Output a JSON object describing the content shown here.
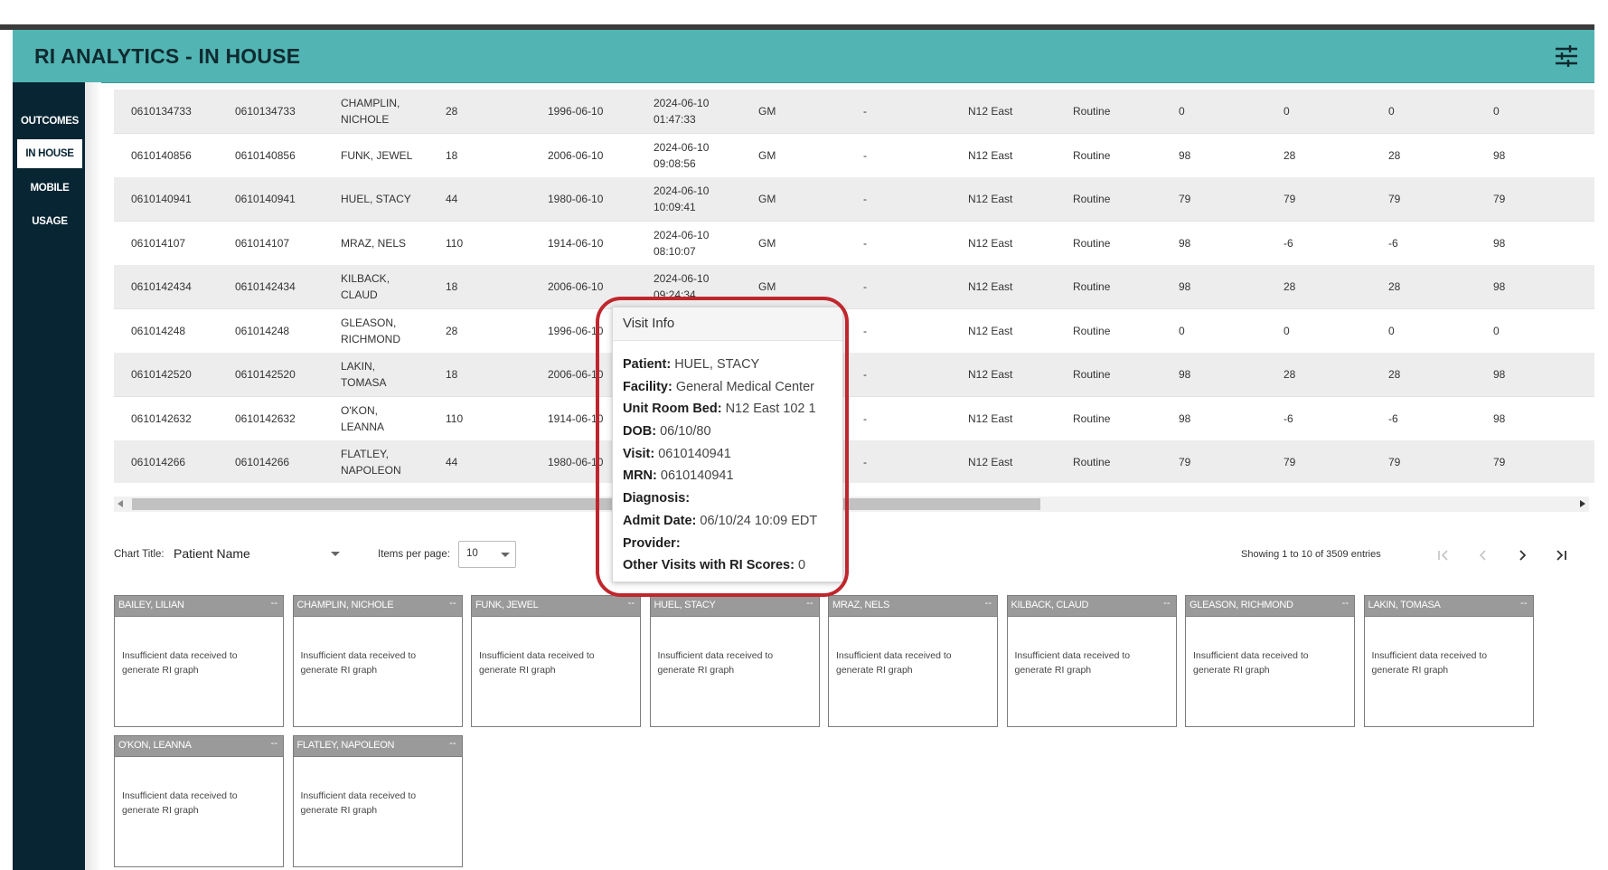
{
  "app": {
    "title": "RI ANALYTICS - IN HOUSE"
  },
  "nav": [
    {
      "label": "OUTCOMES",
      "active": false
    },
    {
      "label": "IN HOUSE",
      "active": true
    },
    {
      "label": "MOBILE",
      "active": false
    },
    {
      "label": "USAGE",
      "active": false
    }
  ],
  "table": {
    "rows": [
      [
        "0610134733",
        "0610134733",
        "CHAMPLIN,\nNICHOLE",
        "28",
        "1996-06-10",
        "2024-06-10\n01:47:33",
        "GM",
        "-",
        "N12 East",
        "Routine",
        "0",
        "0",
        "0",
        "0"
      ],
      [
        "0610140856",
        "0610140856",
        "FUNK, JEWEL",
        "18",
        "2006-06-10",
        "2024-06-10\n09:08:56",
        "GM",
        "-",
        "N12 East",
        "Routine",
        "98",
        "28",
        "28",
        "98"
      ],
      [
        "0610140941",
        "0610140941",
        "HUEL, STACY",
        "44",
        "1980-06-10",
        "2024-06-10\n10:09:41",
        "GM",
        "-",
        "N12 East",
        "Routine",
        "79",
        "79",
        "79",
        "79"
      ],
      [
        "061014107",
        "061014107",
        "MRAZ, NELS",
        "110",
        "1914-06-10",
        "2024-06-10\n08:10:07",
        "GM",
        "-",
        "N12 East",
        "Routine",
        "98",
        "-6",
        "-6",
        "98"
      ],
      [
        "0610142434",
        "0610142434",
        "KILBACK,\nCLAUD",
        "18",
        "2006-06-10",
        "2024-06-10\n09:24:34",
        "GM",
        "-",
        "N12 East",
        "Routine",
        "98",
        "28",
        "28",
        "98"
      ],
      [
        "061014248",
        "061014248",
        "GLEASON,\nRICHMOND",
        "28",
        "1996-06-10",
        "",
        "",
        "-",
        "N12 East",
        "Routine",
        "0",
        "0",
        "0",
        "0"
      ],
      [
        "0610142520",
        "0610142520",
        "LAKIN,\nTOMASA",
        "18",
        "2006-06-10",
        "",
        "",
        "-",
        "N12 East",
        "Routine",
        "98",
        "28",
        "28",
        "98"
      ],
      [
        "0610142632",
        "0610142632",
        "O'KON,\nLEANNA",
        "110",
        "1914-06-10",
        "",
        "",
        "-",
        "N12 East",
        "Routine",
        "98",
        "-6",
        "-6",
        "98"
      ],
      [
        "061014266",
        "061014266",
        "FLATLEY,\nNAPOLEON",
        "44",
        "1980-06-10",
        "",
        "",
        "-",
        "N12 East",
        "Routine",
        "79",
        "79",
        "79",
        "79"
      ]
    ]
  },
  "controls": {
    "chart_title_label": "Chart Title:",
    "chart_title_value": "Patient Name",
    "items_per_page_label": "Items per page:",
    "items_per_page_value": "10",
    "showing_text": "Showing 1 to 10 of 3509 entries"
  },
  "cards": [
    {
      "name": "BAILEY, LILIAN",
      "menu": "--",
      "message": "Insufficient data received to generate RI graph"
    },
    {
      "name": "CHAMPLIN, NICHOLE",
      "menu": "--",
      "message": "Insufficient data received to generate RI graph"
    },
    {
      "name": "FUNK, JEWEL",
      "menu": "--",
      "message": "Insufficient data received to generate RI graph"
    },
    {
      "name": "HUEL, STACY",
      "menu": "--",
      "message": "Insufficient data received to generate RI graph"
    },
    {
      "name": "MRAZ, NELS",
      "menu": "--",
      "message": "Insufficient data received to generate RI graph"
    },
    {
      "name": "KILBACK, CLAUD",
      "menu": "--",
      "message": "Insufficient data received to generate RI graph"
    },
    {
      "name": "GLEASON, RICHMOND",
      "menu": "--",
      "message": "Insufficient data received to generate RI graph"
    },
    {
      "name": "LAKIN, TOMASA",
      "menu": "--",
      "message": "Insufficient data received to generate RI graph"
    },
    {
      "name": "O'KON, LEANNA",
      "menu": "--",
      "message": "Insufficient data received to generate RI graph"
    },
    {
      "name": "FLATLEY, NAPOLEON",
      "menu": "--",
      "message": "Insufficient data received to generate RI graph"
    }
  ],
  "popup": {
    "title": "Visit Info",
    "fields": [
      {
        "label": "Patient:",
        "value": "HUEL, STACY"
      },
      {
        "label": "Facility:",
        "value": "General Medical Center"
      },
      {
        "label": "Unit Room Bed:",
        "value": "N12 East 102 1"
      },
      {
        "label": "DOB:",
        "value": "06/10/80"
      },
      {
        "label": "Visit:",
        "value": "0610140941"
      },
      {
        "label": "MRN:",
        "value": "0610140941"
      },
      {
        "label": "Diagnosis:",
        "value": ""
      },
      {
        "label": "Admit Date:",
        "value": "06/10/24 10:09 EDT"
      },
      {
        "label": "Provider:",
        "value": ""
      },
      {
        "label": "Other Visits with RI Scores:",
        "value": "0"
      }
    ]
  },
  "icons": {
    "filter": "sliders-icon",
    "pager": [
      "first-page-icon",
      "prev-page-icon",
      "next-page-icon",
      "last-page-icon"
    ]
  },
  "colors": {
    "header": "#52b5b3",
    "sidebar": "#082533",
    "highlight": "#c0262d",
    "card_header": "#9a9a9a"
  }
}
